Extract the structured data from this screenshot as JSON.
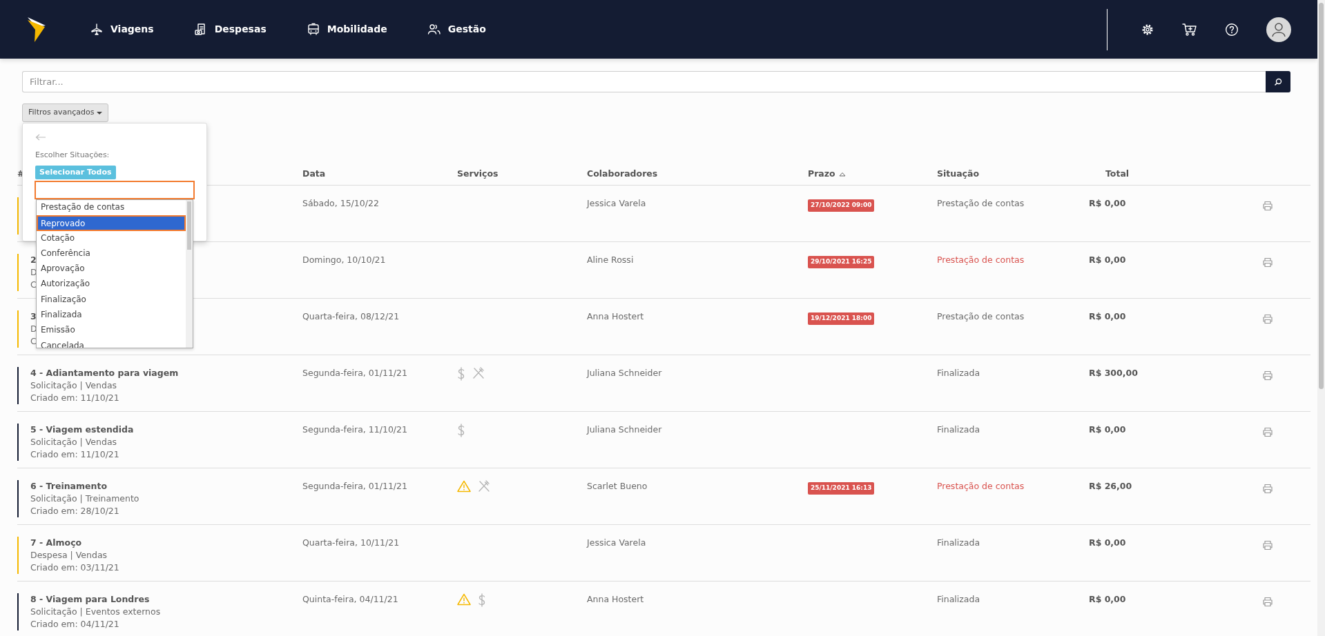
{
  "nav": {
    "items": [
      {
        "label": "Viagens",
        "kind": "plane"
      },
      {
        "label": "Despesas",
        "kind": "receipt"
      },
      {
        "label": "Mobilidade",
        "kind": "bus"
      },
      {
        "label": "Gestão",
        "kind": "people"
      }
    ]
  },
  "filter": {
    "placeholder": "Filtrar..."
  },
  "advanced_filters": {
    "label": "Filtros avançados",
    "expanded": true
  },
  "status_picker": {
    "label": "Escolher Situações:",
    "select_all": "Selecionar Todos",
    "options": [
      {
        "label": "Prestação de contas",
        "selected": false
      },
      {
        "label": "Reprovado",
        "selected": true
      },
      {
        "label": "Cotação",
        "selected": false
      },
      {
        "label": "Conferência",
        "selected": false
      },
      {
        "label": "Aprovação",
        "selected": false
      },
      {
        "label": "Autorização",
        "selected": false
      },
      {
        "label": "Finalização",
        "selected": false
      },
      {
        "label": "Finalizada",
        "selected": false
      },
      {
        "label": "Emissão",
        "selected": false
      },
      {
        "label": "Cancelada",
        "selected": false
      }
    ]
  },
  "table": {
    "columns": [
      {
        "label": "#",
        "sorted": false
      },
      {
        "label": "Data",
        "sorted": false
      },
      {
        "label": "Serviços",
        "sorted": false
      },
      {
        "label": "Colaboradores",
        "sorted": false
      },
      {
        "label": "Prazo",
        "sorted": true
      },
      {
        "label": "Situação",
        "sorted": false
      },
      {
        "label": "Total",
        "sorted": false
      }
    ],
    "rows": [
      {
        "color": "#f5b800",
        "date": "Sábado, 15/10/22",
        "services": [],
        "collaborator": "Jessica Varela",
        "deadline": "27/10/2022 09:00",
        "status": "Prestação de contas",
        "overdue": false,
        "total": "R$ 0,00"
      },
      {
        "color": "#f5b800",
        "title": "2",
        "subtitle": "D",
        "created": "C",
        "date": "Domingo, 10/10/21",
        "services": [],
        "collaborator": "Aline Rossi",
        "deadline": "29/10/2021 16:25",
        "status": "Prestação de contas",
        "overdue": true,
        "total": "R$ 0,00"
      },
      {
        "color": "#f5b800",
        "title": "3",
        "subtitle": "D",
        "created": "C",
        "date": "Quarta-feira, 08/12/21",
        "services": [],
        "collaborator": "Anna Hostert",
        "deadline": "19/12/2021 18:00",
        "status": "Prestação de contas",
        "overdue": false,
        "total": "R$ 0,00"
      },
      {
        "color": "#141c33",
        "title": "4 - Adiantamento para viagem",
        "subtitle": "Solicitação | Vendas",
        "created": "Criado em: 11/10/21",
        "date": "Segunda-feira, 01/11/21",
        "services": [
          {
            "kind": "dollar"
          },
          {
            "kind": "cutlery"
          }
        ],
        "collaborator": "Juliana Schneider",
        "status": "Finalizada",
        "overdue": false,
        "total": "R$ 300,00"
      },
      {
        "color": "#141c33",
        "title": "5 - Viagem estendida",
        "subtitle": "Solicitação | Vendas",
        "created": "Criado em: 11/10/21",
        "date": "Segunda-feira, 11/10/21",
        "services": [
          {
            "kind": "dollar"
          }
        ],
        "collaborator": "Juliana Schneider",
        "status": "Finalizada",
        "overdue": false,
        "total": "R$ 0,00"
      },
      {
        "color": "#141c33",
        "title": "6 - Treinamento",
        "subtitle": "Solicitação | Treinamento",
        "created": "Criado em: 28/10/21",
        "date": "Segunda-feira, 01/11/21",
        "services": [
          {
            "kind": "warning"
          },
          {
            "kind": "cutlery"
          }
        ],
        "collaborator": "Scarlet Bueno",
        "deadline": "25/11/2021 16:13",
        "status": "Prestação de contas",
        "overdue": true,
        "total": "R$ 26,00"
      },
      {
        "color": "#f5b800",
        "title": "7 - Almoço",
        "subtitle": "Despesa | Vendas",
        "created": "Criado em: 03/11/21",
        "date": "Quarta-feira, 10/11/21",
        "services": [],
        "collaborator": "Jessica Varela",
        "status": "Finalizada",
        "overdue": false,
        "total": "R$ 0,00"
      },
      {
        "color": "#141c33",
        "title": "8 - Viagem para Londres",
        "subtitle": "Solicitação | Eventos externos",
        "created": "Criado em: 04/11/21",
        "date": "Quinta-feira, 04/11/21",
        "services": [
          {
            "kind": "warning"
          },
          {
            "kind": "dollar"
          }
        ],
        "collaborator": "Anna Hostert",
        "status": "Finalizada",
        "overdue": false,
        "total": "R$ 0,00"
      }
    ]
  }
}
